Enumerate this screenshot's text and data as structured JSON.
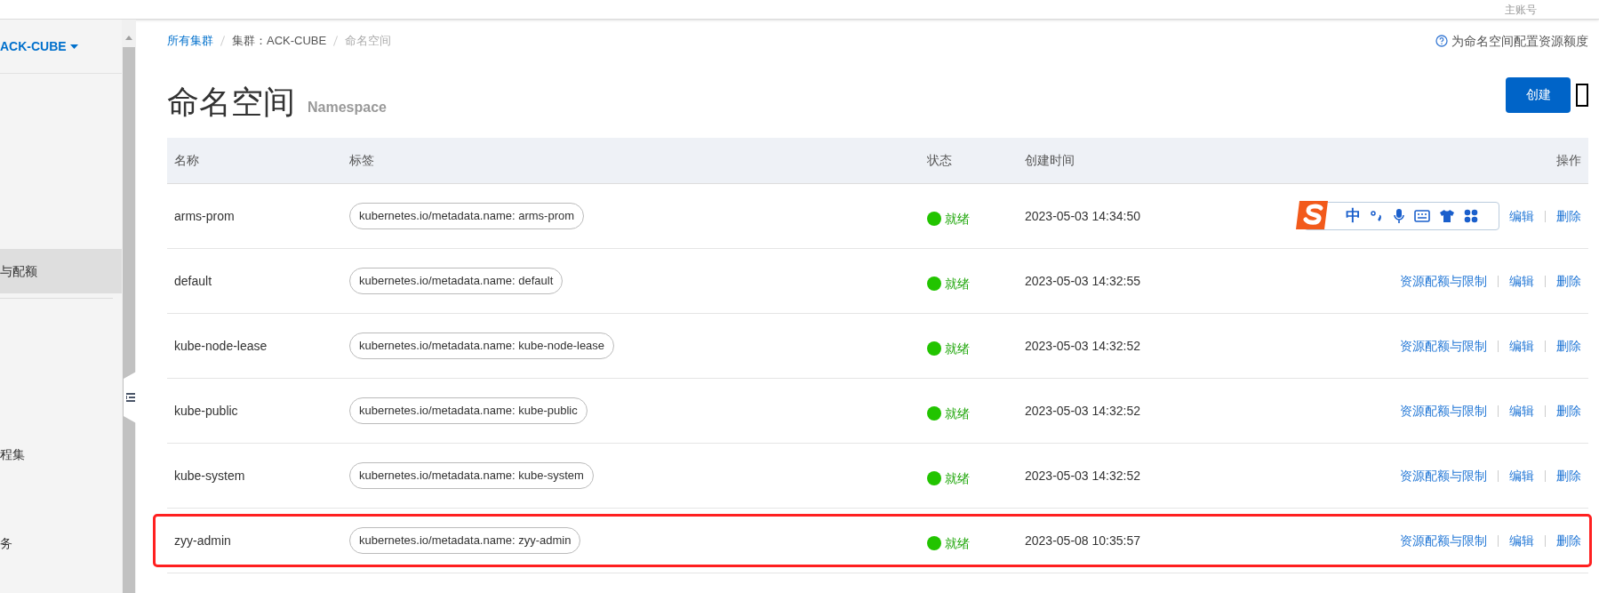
{
  "top_bar": {
    "account": "主账号"
  },
  "sidebar": {
    "cluster": "ACK-CUBE",
    "items": [
      {
        "label": "与配额",
        "selected": true
      },
      {
        "label": "程集",
        "selected": false
      },
      {
        "label": "务",
        "selected": false
      }
    ]
  },
  "breadcrumb": [
    {
      "label": "所有集群",
      "kind": "link"
    },
    {
      "label": "集群：ACK-CUBE",
      "kind": "text"
    },
    {
      "label": "命名空间",
      "kind": "current"
    }
  ],
  "help_link": "为命名空间配置资源额度",
  "page_title": "命名空间",
  "page_subtitle": "Namespace",
  "create_button": "创建",
  "table": {
    "columns": [
      "名称",
      "标签",
      "状态",
      "创建时间",
      "操作"
    ],
    "rows": [
      {
        "name": "arms-prom",
        "label": "kubernetes.io/metadata.name: arms-prom",
        "status": "就绪",
        "created": "2023-05-03 14:34:50",
        "actions": [
          "编辑",
          "删除"
        ],
        "highlighted": false,
        "ime_toolbar": {
          "mode": "中"
        }
      },
      {
        "name": "default",
        "label": "kubernetes.io/metadata.name: default",
        "status": "就绪",
        "created": "2023-05-03 14:32:55",
        "actions": [
          "资源配额与限制",
          "编辑",
          "删除"
        ],
        "highlighted": false
      },
      {
        "name": "kube-node-lease",
        "label": "kubernetes.io/metadata.name: kube-node-lease",
        "status": "就绪",
        "created": "2023-05-03 14:32:52",
        "actions": [
          "资源配额与限制",
          "编辑",
          "删除"
        ],
        "highlighted": false
      },
      {
        "name": "kube-public",
        "label": "kubernetes.io/metadata.name: kube-public",
        "status": "就绪",
        "created": "2023-05-03 14:32:52",
        "actions": [
          "资源配额与限制",
          "编辑",
          "删除"
        ],
        "highlighted": false
      },
      {
        "name": "kube-system",
        "label": "kubernetes.io/metadata.name: kube-system",
        "status": "就绪",
        "created": "2023-05-03 14:32:52",
        "actions": [
          "资源配额与限制",
          "编辑",
          "删除"
        ],
        "highlighted": false
      },
      {
        "name": "zyy-admin",
        "label": "kubernetes.io/metadata.name: zyy-admin",
        "status": "就绪",
        "created": "2023-05-08 10:35:57",
        "actions": [
          "资源配额与限制",
          "编辑",
          "删除"
        ],
        "highlighted": true
      }
    ]
  }
}
